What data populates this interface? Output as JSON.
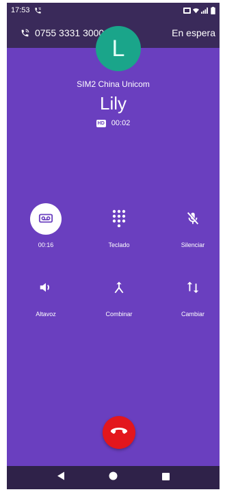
{
  "status_bar": {
    "time": "17:53"
  },
  "call": {
    "number": "0755 3331 3000",
    "hold_label": "En espera",
    "avatar_letter": "L",
    "sim_label": "SIM2 China Unicom",
    "name": "Lily",
    "hd_badge": "HD",
    "duration": "00:02"
  },
  "controls": {
    "record": {
      "label": "00:16"
    },
    "keypad": {
      "label": "Teclado"
    },
    "mute": {
      "label": "Silenciar"
    },
    "speaker": {
      "label": "Altavoz"
    },
    "merge": {
      "label": "Combinar"
    },
    "swap": {
      "label": "Cambiar"
    }
  },
  "colors": {
    "background": "#6a3fbf",
    "top_bar": "#3a2a5a",
    "avatar": "#1aa58a",
    "end_call": "#e3161d",
    "nav_bar": "#2f2249"
  }
}
